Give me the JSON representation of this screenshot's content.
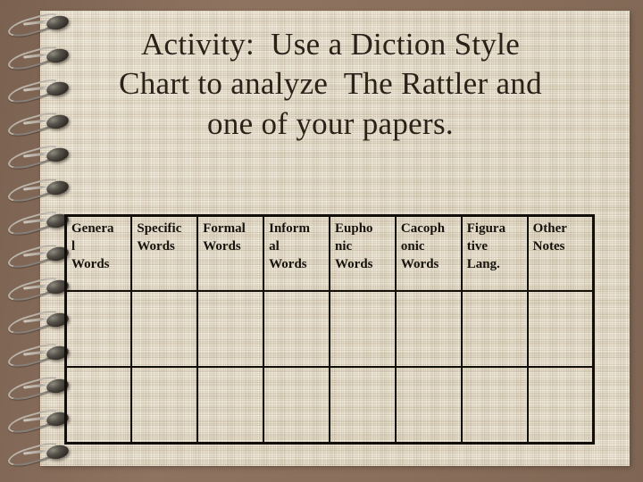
{
  "slide": {
    "title_lines": [
      "Activity:  Use a Diction Style",
      "Chart to analyze  The Rattler and",
      "one of your papers."
    ],
    "title_full": "Activity: Use a Diction Style Chart to analyze The Rattler and one of your papers.",
    "background_color": "#8a6f5c",
    "paper_color": "#ddd4c0",
    "text_color": "#2b2118"
  },
  "chart": {
    "columns": [
      {
        "label": "General Words",
        "lines": [
          "Genera",
          "l",
          "Words"
        ]
      },
      {
        "label": "Specific Words",
        "lines": [
          "Specific",
          "Words",
          ""
        ]
      },
      {
        "label": "Formal Words",
        "lines": [
          "Formal",
          "Words",
          ""
        ]
      },
      {
        "label": "Informal Words",
        "lines": [
          "Inform",
          "al",
          "Words"
        ]
      },
      {
        "label": "Euphonic Words",
        "lines": [
          "Eupho",
          "nic",
          "Words"
        ]
      },
      {
        "label": "Cacophonic Words",
        "lines": [
          "Cacoph",
          "onic",
          "Words"
        ]
      },
      {
        "label": "Figurative Lang.",
        "lines": [
          "Figura",
          "tive",
          "Lang."
        ]
      },
      {
        "label": "Other Notes",
        "lines": [
          "Other",
          "Notes",
          ""
        ]
      }
    ],
    "rows": [
      [
        "",
        "",
        "",
        "",
        "",
        "",
        "",
        ""
      ],
      [
        "",
        "",
        "",
        "",
        "",
        "",
        "",
        ""
      ]
    ]
  }
}
